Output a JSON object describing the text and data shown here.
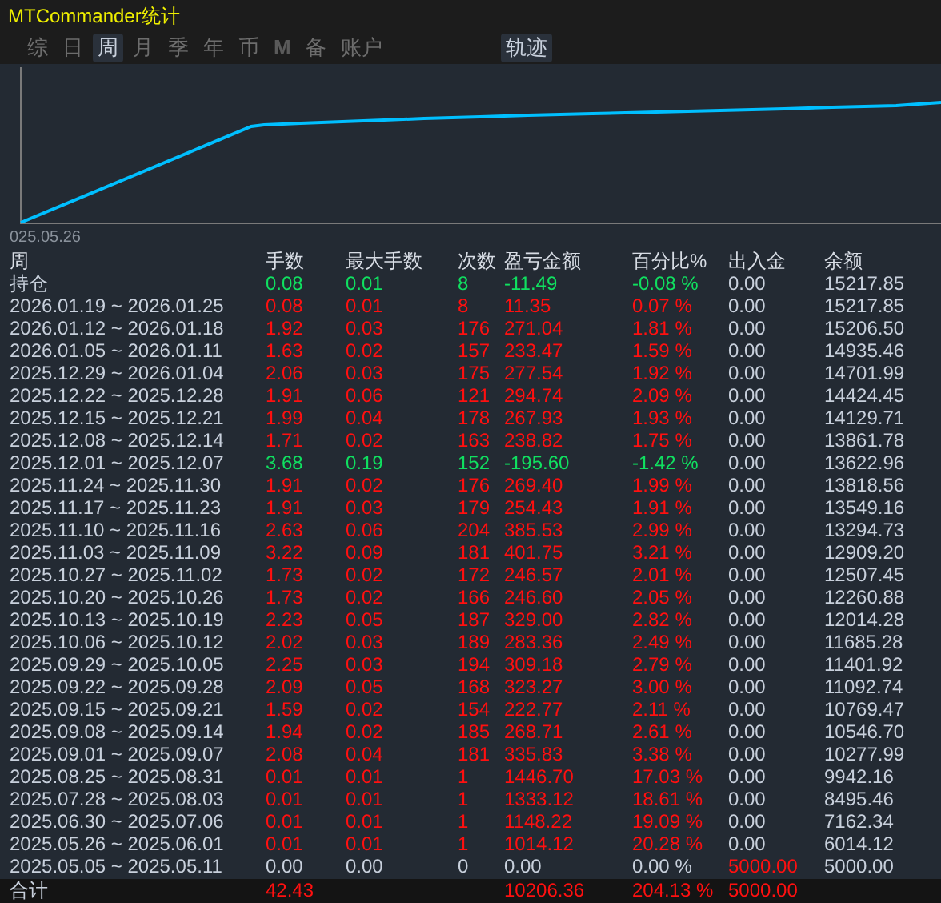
{
  "window": {
    "title": "MTCommander统计"
  },
  "tabs": [
    {
      "label": "综",
      "selected": false,
      "dim": false
    },
    {
      "label": "日",
      "selected": false,
      "dim": false
    },
    {
      "label": "周",
      "selected": true,
      "dim": false
    },
    {
      "label": "月",
      "selected": false,
      "dim": false
    },
    {
      "label": "季",
      "selected": false,
      "dim": false
    },
    {
      "label": "年",
      "selected": false,
      "dim": false
    },
    {
      "label": "币",
      "selected": false,
      "dim": false
    },
    {
      "label": "M",
      "selected": false,
      "dim": true
    },
    {
      "label": "备",
      "selected": false,
      "dim": false
    },
    {
      "label": "账户",
      "selected": false,
      "dim": false
    }
  ],
  "view_toggle": {
    "label": "轨迹",
    "selected": true
  },
  "equity_chart": {
    "start_label": "025.05.26"
  },
  "table": {
    "columns": [
      "周",
      "手数",
      "最大手数",
      "次数",
      "盈亏金额",
      "百分比%",
      "出入金",
      "余额"
    ],
    "rows": [
      {
        "period": "持仓",
        "lots": "0.08",
        "max_lots": "0.01",
        "trades": "8",
        "pnl": "-11.49",
        "percent": "-0.08 %",
        "cash_flow": "0.00",
        "balance": "15217.85",
        "kind": "down",
        "cash_flow_highlight": false
      },
      {
        "period": "2026.01.19 ~ 2026.01.25",
        "lots": "0.08",
        "max_lots": "0.01",
        "trades": "8",
        "pnl": "11.35",
        "percent": "0.07 %",
        "cash_flow": "0.00",
        "balance": "15217.85",
        "kind": "up",
        "cash_flow_highlight": false
      },
      {
        "period": "2026.01.12 ~ 2026.01.18",
        "lots": "1.92",
        "max_lots": "0.03",
        "trades": "176",
        "pnl": "271.04",
        "percent": "1.81 %",
        "cash_flow": "0.00",
        "balance": "15206.50",
        "kind": "up",
        "cash_flow_highlight": false
      },
      {
        "period": "2026.01.05 ~ 2026.01.11",
        "lots": "1.63",
        "max_lots": "0.02",
        "trades": "157",
        "pnl": "233.47",
        "percent": "1.59 %",
        "cash_flow": "0.00",
        "balance": "14935.46",
        "kind": "up",
        "cash_flow_highlight": false
      },
      {
        "period": "2025.12.29 ~ 2026.01.04",
        "lots": "2.06",
        "max_lots": "0.03",
        "trades": "175",
        "pnl": "277.54",
        "percent": "1.92 %",
        "cash_flow": "0.00",
        "balance": "14701.99",
        "kind": "up",
        "cash_flow_highlight": false
      },
      {
        "period": "2025.12.22 ~ 2025.12.28",
        "lots": "1.91",
        "max_lots": "0.06",
        "trades": "121",
        "pnl": "294.74",
        "percent": "2.09 %",
        "cash_flow": "0.00",
        "balance": "14424.45",
        "kind": "up",
        "cash_flow_highlight": false
      },
      {
        "period": "2025.12.15 ~ 2025.12.21",
        "lots": "1.99",
        "max_lots": "0.04",
        "trades": "178",
        "pnl": "267.93",
        "percent": "1.93 %",
        "cash_flow": "0.00",
        "balance": "14129.71",
        "kind": "up",
        "cash_flow_highlight": false
      },
      {
        "period": "2025.12.08 ~ 2025.12.14",
        "lots": "1.71",
        "max_lots": "0.02",
        "trades": "163",
        "pnl": "238.82",
        "percent": "1.75 %",
        "cash_flow": "0.00",
        "balance": "13861.78",
        "kind": "up",
        "cash_flow_highlight": false
      },
      {
        "period": "2025.12.01 ~ 2025.12.07",
        "lots": "3.68",
        "max_lots": "0.19",
        "trades": "152",
        "pnl": "-195.60",
        "percent": "-1.42 %",
        "cash_flow": "0.00",
        "balance": "13622.96",
        "kind": "down",
        "cash_flow_highlight": false
      },
      {
        "period": "2025.11.24 ~ 2025.11.30",
        "lots": "1.91",
        "max_lots": "0.02",
        "trades": "176",
        "pnl": "269.40",
        "percent": "1.99 %",
        "cash_flow": "0.00",
        "balance": "13818.56",
        "kind": "up",
        "cash_flow_highlight": false
      },
      {
        "period": "2025.11.17 ~ 2025.11.23",
        "lots": "1.91",
        "max_lots": "0.03",
        "trades": "179",
        "pnl": "254.43",
        "percent": "1.91 %",
        "cash_flow": "0.00",
        "balance": "13549.16",
        "kind": "up",
        "cash_flow_highlight": false
      },
      {
        "period": "2025.11.10 ~ 2025.11.16",
        "lots": "2.63",
        "max_lots": "0.06",
        "trades": "204",
        "pnl": "385.53",
        "percent": "2.99 %",
        "cash_flow": "0.00",
        "balance": "13294.73",
        "kind": "up",
        "cash_flow_highlight": false
      },
      {
        "period": "2025.11.03 ~ 2025.11.09",
        "lots": "3.22",
        "max_lots": "0.09",
        "trades": "181",
        "pnl": "401.75",
        "percent": "3.21 %",
        "cash_flow": "0.00",
        "balance": "12909.20",
        "kind": "up",
        "cash_flow_highlight": false
      },
      {
        "period": "2025.10.27 ~ 2025.11.02",
        "lots": "1.73",
        "max_lots": "0.02",
        "trades": "172",
        "pnl": "246.57",
        "percent": "2.01 %",
        "cash_flow": "0.00",
        "balance": "12507.45",
        "kind": "up",
        "cash_flow_highlight": false
      },
      {
        "period": "2025.10.20 ~ 2025.10.26",
        "lots": "1.73",
        "max_lots": "0.02",
        "trades": "166",
        "pnl": "246.60",
        "percent": "2.05 %",
        "cash_flow": "0.00",
        "balance": "12260.88",
        "kind": "up",
        "cash_flow_highlight": false
      },
      {
        "period": "2025.10.13 ~ 2025.10.19",
        "lots": "2.23",
        "max_lots": "0.05",
        "trades": "187",
        "pnl": "329.00",
        "percent": "2.82 %",
        "cash_flow": "0.00",
        "balance": "12014.28",
        "kind": "up",
        "cash_flow_highlight": false
      },
      {
        "period": "2025.10.06 ~ 2025.10.12",
        "lots": "2.02",
        "max_lots": "0.03",
        "trades": "189",
        "pnl": "283.36",
        "percent": "2.49 %",
        "cash_flow": "0.00",
        "balance": "11685.28",
        "kind": "up",
        "cash_flow_highlight": false
      },
      {
        "period": "2025.09.29 ~ 2025.10.05",
        "lots": "2.25",
        "max_lots": "0.03",
        "trades": "194",
        "pnl": "309.18",
        "percent": "2.79 %",
        "cash_flow": "0.00",
        "balance": "11401.92",
        "kind": "up",
        "cash_flow_highlight": false
      },
      {
        "period": "2025.09.22 ~ 2025.09.28",
        "lots": "2.09",
        "max_lots": "0.05",
        "trades": "168",
        "pnl": "323.27",
        "percent": "3.00 %",
        "cash_flow": "0.00",
        "balance": "11092.74",
        "kind": "up",
        "cash_flow_highlight": false
      },
      {
        "period": "2025.09.15 ~ 2025.09.21",
        "lots": "1.59",
        "max_lots": "0.02",
        "trades": "154",
        "pnl": "222.77",
        "percent": "2.11 %",
        "cash_flow": "0.00",
        "balance": "10769.47",
        "kind": "up",
        "cash_flow_highlight": false
      },
      {
        "period": "2025.09.08 ~ 2025.09.14",
        "lots": "1.94",
        "max_lots": "0.02",
        "trades": "185",
        "pnl": "268.71",
        "percent": "2.61 %",
        "cash_flow": "0.00",
        "balance": "10546.70",
        "kind": "up",
        "cash_flow_highlight": false
      },
      {
        "period": "2025.09.01 ~ 2025.09.07",
        "lots": "2.08",
        "max_lots": "0.04",
        "trades": "181",
        "pnl": "335.83",
        "percent": "3.38 %",
        "cash_flow": "0.00",
        "balance": "10277.99",
        "kind": "up",
        "cash_flow_highlight": false
      },
      {
        "period": "2025.08.25 ~ 2025.08.31",
        "lots": "0.01",
        "max_lots": "0.01",
        "trades": "1",
        "pnl": "1446.70",
        "percent": "17.03 %",
        "cash_flow": "0.00",
        "balance": "9942.16",
        "kind": "up",
        "cash_flow_highlight": false
      },
      {
        "period": "2025.07.28 ~ 2025.08.03",
        "lots": "0.01",
        "max_lots": "0.01",
        "trades": "1",
        "pnl": "1333.12",
        "percent": "18.61 %",
        "cash_flow": "0.00",
        "balance": "8495.46",
        "kind": "up",
        "cash_flow_highlight": false
      },
      {
        "period": "2025.06.30 ~ 2025.07.06",
        "lots": "0.01",
        "max_lots": "0.01",
        "trades": "1",
        "pnl": "1148.22",
        "percent": "19.09 %",
        "cash_flow": "0.00",
        "balance": "7162.34",
        "kind": "up",
        "cash_flow_highlight": false
      },
      {
        "period": "2025.05.26 ~ 2025.06.01",
        "lots": "0.01",
        "max_lots": "0.01",
        "trades": "1",
        "pnl": "1014.12",
        "percent": "20.28 %",
        "cash_flow": "0.00",
        "balance": "6014.12",
        "kind": "up",
        "cash_flow_highlight": false
      },
      {
        "period": "2025.05.05 ~ 2025.05.11",
        "lots": "0.00",
        "max_lots": "0.00",
        "trades": "0",
        "pnl": "0.00",
        "percent": "0.00 %",
        "cash_flow": "5000.00",
        "balance": "5000.00",
        "kind": "flat",
        "cash_flow_highlight": true
      }
    ],
    "total": {
      "label": "合计",
      "lots": "42.43",
      "pnl": "10206.36",
      "percent": "204.13 %",
      "cash_flow": "5000.00"
    }
  }
}
